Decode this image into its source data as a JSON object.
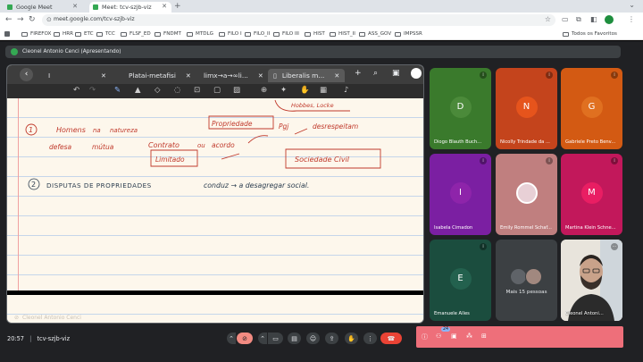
{
  "browser": {
    "tabs": [
      {
        "title": "Google Meet",
        "active": false
      },
      {
        "title": "Meet: tcv-szjb-viz",
        "active": true
      }
    ],
    "url": "meet.google.com/tcv-szjb-viz",
    "bookmarks": [
      "FIREFOX",
      "HRR",
      "ETC",
      "TCC",
      "FLSF_ED",
      "FNDMT",
      "MTDLG",
      "FILO I",
      "FILO_II",
      "FILO III",
      "HIST",
      "HIST_II",
      "ASS_GOV",
      "IMPSSR"
    ],
    "all_bookmarks_label": "Todos os Favoritos"
  },
  "meet": {
    "presenting_banner": "Cleonel Antonio Cenci (Apresentando)",
    "doc_tabs": [
      {
        "label": "I",
        "active": false
      },
      {
        "label": "Platai-metafisi",
        "active": false
      },
      {
        "label": "limx→a→∞li...",
        "active": false
      },
      {
        "label": "Liberalis m...",
        "active": true
      }
    ],
    "presenter_overlay": "Cleonel Antonio Cenci",
    "participants": [
      {
        "initial": "D",
        "name": "Diogo Blauth Buch...",
        "bg": "#3a7a2c",
        "avatar": "#4b8a3a"
      },
      {
        "initial": "N",
        "name": "Nicolly Trindade da ...",
        "bg": "#c4441c",
        "avatar": "#e6541c"
      },
      {
        "initial": "G",
        "name": "Gabriele Preto Benv...",
        "bg": "#d35a13",
        "avatar": "#e07020"
      },
      {
        "initial": "I",
        "name": "Isabela Cimadon",
        "bg": "#7b1fa2",
        "avatar": "#8e24aa"
      },
      {
        "initial": "",
        "name": "Emily Rommel Schaf...",
        "bg": "#c07f7f",
        "avatar": "#e8d0d6"
      },
      {
        "initial": "M",
        "name": "Martina Klein Schne...",
        "bg": "#c2185b",
        "avatar": "#e91e63"
      },
      {
        "initial": "E",
        "name": "Emanuele Alles",
        "bg": "#1b4d3e",
        "avatar": "#23614e"
      }
    ],
    "more_people_label": "Mais 15 pessoas",
    "self_name": "Cleonel Antoni...",
    "meeting_time": "20:57",
    "meeting_code": "tcv-szjb-viz",
    "chat_badge": "24"
  },
  "notes": {
    "line1_item": "1",
    "line1_words": [
      "Homens",
      "na",
      "natureza",
      "Propriedade",
      "Pgj",
      "desrespeitam",
      "defesa",
      "mútua",
      "Contrato",
      "ou",
      "acordo",
      "Limitado",
      "Sociedade Civil",
      "Hobbes, Locke"
    ],
    "line2_item": "2",
    "line2_text": "DISPUTAS DE PROPRIEDADES",
    "line2_rest": "conduz → a desagregar social."
  }
}
